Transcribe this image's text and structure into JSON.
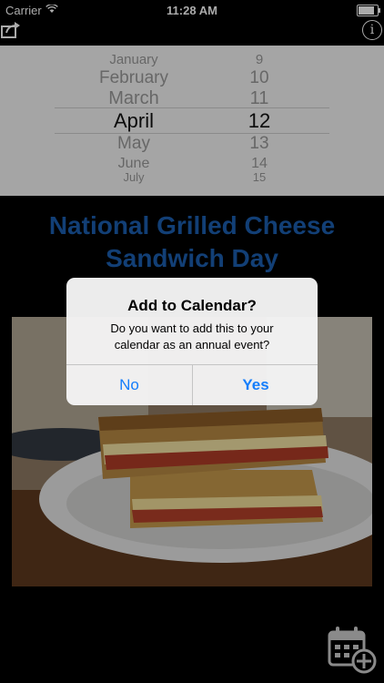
{
  "status_bar": {
    "carrier": "Carrier",
    "time": "11:28 AM"
  },
  "picker": {
    "rows": [
      {
        "month": "January",
        "day": "9"
      },
      {
        "month": "February",
        "day": "10"
      },
      {
        "month": "March",
        "day": "11"
      },
      {
        "month": "April",
        "day": "12",
        "selected": true
      },
      {
        "month": "May",
        "day": "13"
      },
      {
        "month": "June",
        "day": "14"
      },
      {
        "month": "July",
        "day": "15"
      }
    ]
  },
  "headline": {
    "line1": "National Grilled Cheese",
    "line2": "Sandwich Day"
  },
  "alert": {
    "title": "Add to Calendar?",
    "message_line1": "Do you want to add this to your",
    "message_line2": "calendar as an annual event?",
    "no_label": "No",
    "yes_label": "Yes"
  },
  "icons": {
    "share": "share-icon",
    "info": "info-icon",
    "calendar_add": "calendar-add-icon"
  },
  "colors": {
    "headline": "#1c5fb0",
    "alert_button": "#157efb",
    "picker_bg": "#f6f6f6"
  }
}
